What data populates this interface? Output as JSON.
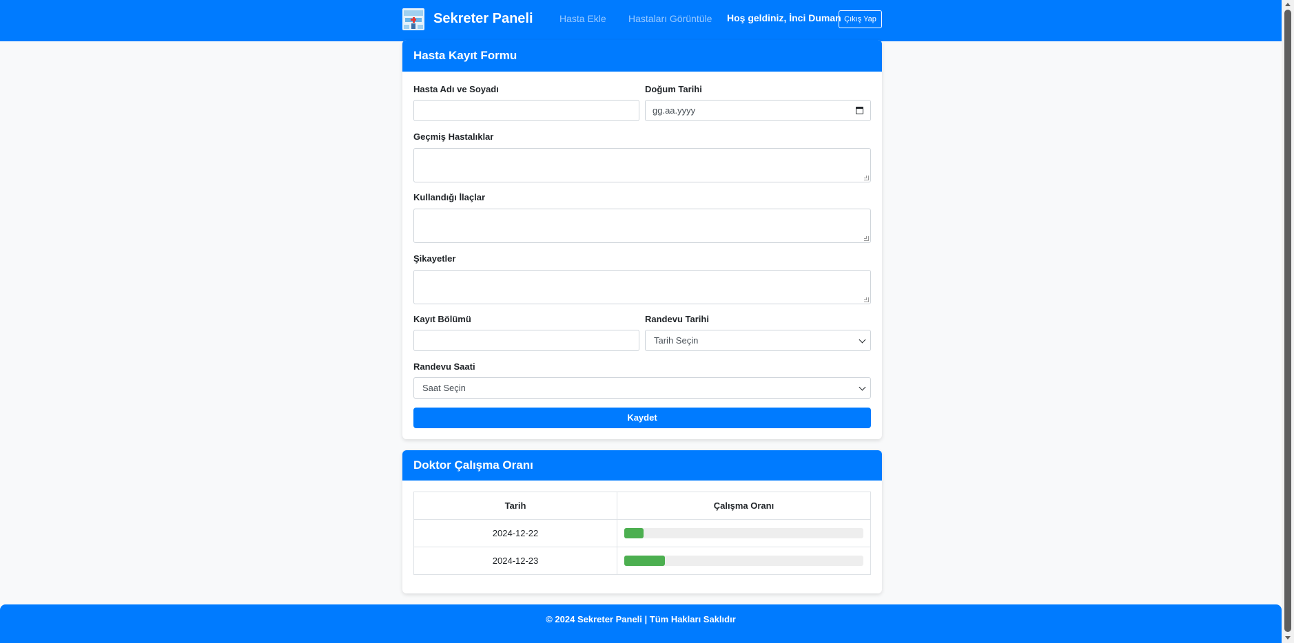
{
  "navbar": {
    "brand_title": "Sekreter Paneli",
    "logo_icon": "hospital-building-icon",
    "links": [
      "Hasta Ekle",
      "Hastaları Görüntüle"
    ],
    "welcome": "Hoş geldiniz, İnci Duman",
    "logout_label": "Çıkış Yap",
    "color": "#007bff"
  },
  "form": {
    "title": "Hasta Kayıt Formu",
    "fields": {
      "name": {
        "label": "Hasta Adı ve Soyadı",
        "value": ""
      },
      "birth_date": {
        "label": "Doğum Tarihi",
        "placeholder": "gg.aa.yyyy"
      },
      "past_illnesses": {
        "label": "Geçmiş Hastalıklar",
        "value": ""
      },
      "medications": {
        "label": "Kullandığı İlaçlar",
        "value": ""
      },
      "complaints": {
        "label": "Şikayetler",
        "value": ""
      },
      "department": {
        "label": "Kayıt Bölümü",
        "value": ""
      },
      "appointment_date": {
        "label": "Randevu Tarihi",
        "selected": "Tarih Seçin"
      },
      "appointment_time": {
        "label": "Randevu Saati",
        "selected": "Saat Seçin"
      }
    },
    "save_label": "Kaydet"
  },
  "rate_table": {
    "title": "Doktor Çalışma Oranı",
    "headers": [
      "Tarih",
      "Çalışma Oranı"
    ],
    "rows": [
      {
        "date": "2024-12-22",
        "rate": 0.08
      },
      {
        "date": "2024-12-23",
        "rate": 0.17
      }
    ],
    "bar_color": "#4caf50"
  },
  "footer": {
    "text": "© 2024 Sekreter Paneli | Tüm Hakları Saklıdır"
  }
}
